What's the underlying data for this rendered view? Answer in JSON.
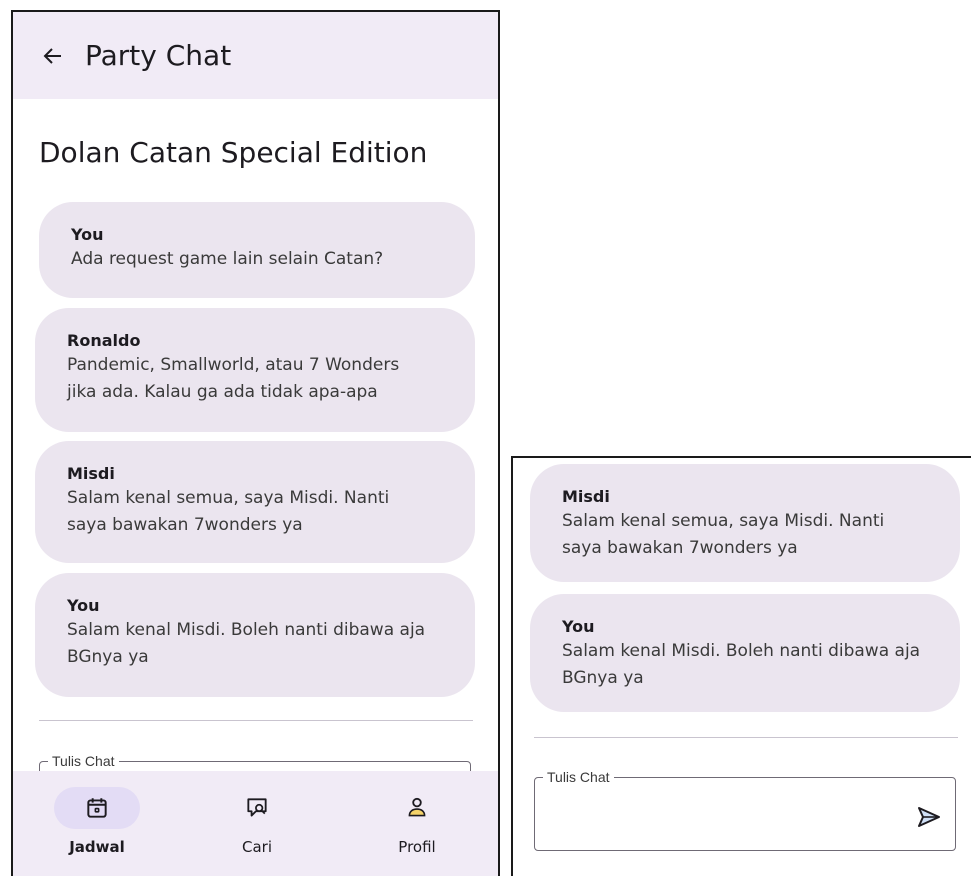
{
  "app_bar": {
    "title": "Party Chat"
  },
  "event": {
    "title": "Dolan Catan Special Edition"
  },
  "messages": [
    {
      "sender": "You",
      "lines": [
        "Ada request game lain selain Catan?"
      ]
    },
    {
      "sender": "Ronaldo",
      "lines": [
        "Pandemic, Smallworld, atau 7 Wonders",
        "jika ada. Kalau ga ada tidak apa-apa"
      ]
    },
    {
      "sender": "Misdi",
      "lines": [
        "Salam kenal semua, saya Misdi. Nanti",
        "saya bawakan 7wonders ya"
      ]
    },
    {
      "sender": "You",
      "lines": [
        "Salam kenal Misdi. Boleh nanti dibawa aja",
        "BGnya ya"
      ]
    }
  ],
  "chat_input": {
    "label": "Tulis Chat",
    "value": ""
  },
  "bottom_nav": [
    {
      "label": "Jadwal",
      "icon": "calendar-icon",
      "active": true
    },
    {
      "label": "Cari",
      "icon": "search-chat-icon",
      "active": false
    },
    {
      "label": "Profil",
      "icon": "profile-icon",
      "active": false
    }
  ],
  "colors": {
    "app_bar_bg": "#f1ebf6",
    "bubble_bg": "#ebe5ef",
    "nav_active_pill": "#e3dcf5"
  }
}
